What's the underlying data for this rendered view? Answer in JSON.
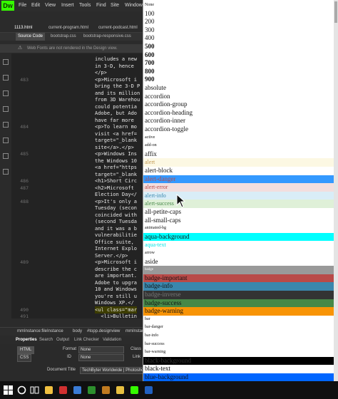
{
  "app": {
    "logo": "Dw",
    "menu": [
      "File",
      "Edit",
      "View",
      "Insert",
      "Tools",
      "Find",
      "Site",
      "Window"
    ],
    "tabs": [
      "1113.html",
      "current-program.html",
      "current-podcast.html"
    ],
    "toolbar": [
      "Source Code",
      "bootstrap.css",
      "bootstrap-responsive.css"
    ],
    "notice": "Web Fonts are not rendered in the Design view.",
    "lines": [
      {
        "n": "",
        "t": "includes a new"
      },
      {
        "n": "",
        "t": "in 3-D, hence"
      },
      {
        "n": "",
        "t": "</p>"
      },
      {
        "n": "483",
        "t": "<p>Microsoft i"
      },
      {
        "n": "",
        "t": "bring the 3-D P"
      },
      {
        "n": "",
        "t": "and its million"
      },
      {
        "n": "",
        "t": "from 3D Warehou"
      },
      {
        "n": "",
        "t": "could potentia"
      },
      {
        "n": "",
        "t": "Adobe, but Ado"
      },
      {
        "n": "",
        "t": "have far more"
      },
      {
        "n": "484",
        "t": "<p>To learn mo"
      },
      {
        "n": "",
        "t": "visit <a href="
      },
      {
        "n": "",
        "t": "target=\"_blank"
      },
      {
        "n": "",
        "t": "site</a>.</p>"
      },
      {
        "n": "485",
        "t": "<p>Windows Ins"
      },
      {
        "n": "",
        "t": "the Windows 10"
      },
      {
        "n": "",
        "t": "<a href=\"https"
      },
      {
        "n": "",
        "t": "target=\"_blank"
      },
      {
        "n": "486",
        "t": "<h1>Short Circ"
      },
      {
        "n": "487",
        "t": "<h2>Microsoft"
      },
      {
        "n": "",
        "t": "Election Day</"
      },
      {
        "n": "488",
        "t": "<p>It's only a"
      },
      {
        "n": "",
        "t": "Tuesday (secon"
      },
      {
        "n": "",
        "t": "coincided with"
      },
      {
        "n": "",
        "t": "(second Tuesda"
      },
      {
        "n": "",
        "t": "and it was a b"
      },
      {
        "n": "",
        "t": "vulnerabilitie"
      },
      {
        "n": "",
        "t": "Office suite,"
      },
      {
        "n": "",
        "t": "Internet Explo"
      },
      {
        "n": "",
        "t": "Server.</p>"
      },
      {
        "n": "489",
        "t": "<p>Microsoft i"
      },
      {
        "n": "",
        "t": "describe the c"
      },
      {
        "n": "",
        "t": "are important."
      },
      {
        "n": "",
        "t": "Adobe to upgra"
      },
      {
        "n": "",
        "t": "10 and Windows"
      },
      {
        "n": "",
        "t": "you're still u"
      },
      {
        "n": "",
        "t": "Windows XP.</"
      },
      {
        "n": "490",
        "t": "<ul class=\"mar"
      },
      {
        "n": "491",
        "t": "  <li>Bulletin"
      }
    ],
    "breadcrumb": [
      "mmInstance:fileInstance",
      "body",
      "#topp.designview",
      "mmInstance"
    ],
    "props_tabs": [
      "Properties",
      "Search",
      "Output",
      "Link Checker",
      "Validation"
    ],
    "props": {
      "html_btn": "HTML",
      "css_btn": "CSS",
      "format_label": "Format",
      "format_value": "None",
      "id_label": "ID",
      "id_value": "None",
      "class_label": "Class",
      "link_label": "Link",
      "doc_title_label": "Document Title",
      "doc_title_value": "TechByter Worldwide | Photoshop"
    }
  },
  "dropdown": {
    "selected_index": 20,
    "options": [
      {
        "label": "None",
        "size": 6,
        "bg": "#ffffff",
        "color": "#111111",
        "bold": false
      },
      {
        "label": "100",
        "size": 9,
        "bg": "#ffffff",
        "color": "#111111",
        "bold": false
      },
      {
        "label": "200",
        "size": 9,
        "bg": "#ffffff",
        "color": "#111111",
        "bold": false
      },
      {
        "label": "300",
        "size": 9,
        "bg": "#ffffff",
        "color": "#111111",
        "bold": false
      },
      {
        "label": "400",
        "size": 9,
        "bg": "#ffffff",
        "color": "#111111",
        "bold": false
      },
      {
        "label": "500",
        "size": 9,
        "bg": "#ffffff",
        "color": "#111111",
        "bold": true
      },
      {
        "label": "600",
        "size": 9,
        "bg": "#ffffff",
        "color": "#111111",
        "bold": true
      },
      {
        "label": "700",
        "size": 9,
        "bg": "#ffffff",
        "color": "#111111",
        "bold": true
      },
      {
        "label": "800",
        "size": 9,
        "bg": "#ffffff",
        "color": "#111111",
        "bold": true
      },
      {
        "label": "900",
        "size": 9,
        "bg": "#ffffff",
        "color": "#111111",
        "bold": true
      },
      {
        "label": "absolute",
        "size": 9,
        "bg": "#ffffff",
        "color": "#111111",
        "bold": false
      },
      {
        "label": "accordion",
        "size": 9,
        "bg": "#ffffff",
        "color": "#111111",
        "bold": false
      },
      {
        "label": "accordion-group",
        "size": 9,
        "bg": "#ffffff",
        "color": "#111111",
        "bold": false
      },
      {
        "label": "accordion-heading",
        "size": 9,
        "bg": "#ffffff",
        "color": "#111111",
        "bold": false
      },
      {
        "label": "accordion-inner",
        "size": 9,
        "bg": "#ffffff",
        "color": "#111111",
        "bold": false
      },
      {
        "label": "accordion-toggle",
        "size": 9,
        "bg": "#ffffff",
        "color": "#111111",
        "bold": false
      },
      {
        "label": "active",
        "size": 6,
        "bg": "#ffffff",
        "color": "#111111",
        "bold": false
      },
      {
        "label": "add-on",
        "size": 6,
        "bg": "#ffffff",
        "color": "#111111",
        "bold": false
      },
      {
        "label": "affix",
        "size": 9,
        "bg": "#ffffff",
        "color": "#111111",
        "bold": false
      },
      {
        "label": "alert",
        "size": 8,
        "bg": "#fcf8e3",
        "color": "#c09853",
        "bold": false
      },
      {
        "label": "alert-block",
        "size": 9,
        "bg": "#ffffff",
        "color": "#111111",
        "bold": false
      },
      {
        "label": "alert-danger",
        "size": 9,
        "bg": "#3399ff",
        "color": "#b94a48",
        "bold": false
      },
      {
        "label": "alert-error",
        "size": 8,
        "bg": "#f2dede",
        "color": "#b94a48",
        "bold": false
      },
      {
        "label": "alert-info",
        "size": 8,
        "bg": "#d9edf7",
        "color": "#3a87ad",
        "bold": false
      },
      {
        "label": "alert-success",
        "size": 8,
        "bg": "#dff0d8",
        "color": "#468847",
        "bold": false
      },
      {
        "label": "all-petite-caps",
        "size": 9,
        "bg": "#ffffff",
        "color": "#111111",
        "bold": false
      },
      {
        "label": "all-small-caps",
        "size": 9,
        "bg": "#ffffff",
        "color": "#111111",
        "bold": false
      },
      {
        "label": "animated-bg",
        "size": 6,
        "bg": "#ffffff",
        "color": "#111111",
        "bold": false
      },
      {
        "label": "aqua-background",
        "size": 9,
        "bg": "#00ffff",
        "color": "#111111",
        "bold": false
      },
      {
        "label": "aqua-text",
        "size": 8,
        "bg": "#ffffff",
        "color": "#00e5e5",
        "bold": false
      },
      {
        "label": "arrow",
        "size": 6,
        "bg": "#ffffff",
        "color": "#111111",
        "bold": false
      },
      {
        "label": "aside",
        "size": 9,
        "bg": "#ffffff",
        "color": "#111111",
        "bold": false
      },
      {
        "label": "badge",
        "size": 5,
        "bg": "#999999",
        "color": "#ffffff",
        "bold": false
      },
      {
        "label": "badge-important",
        "size": 9,
        "bg": "#b94a48",
        "color": "#111111",
        "bold": false
      },
      {
        "label": "badge-info",
        "size": 9,
        "bg": "#3a87ad",
        "color": "#111111",
        "bold": false
      },
      {
        "label": "badge-inverse",
        "size": 9,
        "bg": "#333333",
        "color": "#777777",
        "bold": false
      },
      {
        "label": "badge-success",
        "size": 9,
        "bg": "#468847",
        "color": "#111111",
        "bold": false
      },
      {
        "label": "badge-warning",
        "size": 9,
        "bg": "#f89406",
        "color": "#111111",
        "bold": false
      },
      {
        "label": "bar",
        "size": 6,
        "bg": "#ffffff",
        "color": "#111111",
        "bold": false
      },
      {
        "label": "bar-danger",
        "size": 6,
        "bg": "#ffffff",
        "color": "#111111",
        "bold": false
      },
      {
        "label": "bar-info",
        "size": 6,
        "bg": "#ffffff",
        "color": "#111111",
        "bold": false
      },
      {
        "label": "bar-success",
        "size": 6,
        "bg": "#ffffff",
        "color": "#111111",
        "bold": false
      },
      {
        "label": "bar-warning",
        "size": 6,
        "bg": "#ffffff",
        "color": "#111111",
        "bold": false
      },
      {
        "label": "black-background",
        "size": 9,
        "bg": "#000000",
        "color": "#333333",
        "bold": false
      },
      {
        "label": "black-text",
        "size": 9,
        "bg": "#ffffff",
        "color": "#000000",
        "bold": false
      },
      {
        "label": "blue-background",
        "size": 9,
        "bg": "#0066ff",
        "color": "#111111",
        "bold": false
      }
    ]
  }
}
